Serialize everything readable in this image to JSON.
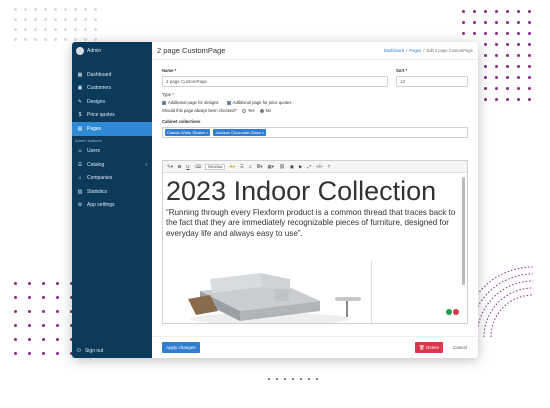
{
  "sidebar": {
    "user": "Admin",
    "items": [
      {
        "label": "Dashboard",
        "icon": "dashboard-icon"
      },
      {
        "label": "Customers",
        "icon": "customers-icon"
      },
      {
        "label": "Designs",
        "icon": "designs-icon"
      },
      {
        "label": "Price quotes",
        "icon": "price-icon"
      },
      {
        "label": "Pages",
        "icon": "pages-icon"
      }
    ],
    "section": "Admin features",
    "admin_items": [
      {
        "label": "Users",
        "icon": "users-icon"
      },
      {
        "label": "Catalog",
        "icon": "catalog-icon"
      },
      {
        "label": "Companies",
        "icon": "companies-icon"
      },
      {
        "label": "Statistics",
        "icon": "statistics-icon"
      },
      {
        "label": "App settings",
        "icon": "settings-icon"
      }
    ],
    "signout": "Sign out"
  },
  "header": {
    "title": "2 page CustomPage",
    "breadcrumb": [
      "Dashboard",
      "Pages",
      "Edit 2 page CustomPage"
    ]
  },
  "form": {
    "name_label": "Name *",
    "name_value": "2 page CustomPage",
    "sort_label": "Sort *",
    "sort_value": "12",
    "type_label": "Type *",
    "opt_designs": "Additional page for designs",
    "opt_quotes": "Additional page for price quotes",
    "always_checked": "Should this page always been checked?",
    "yes": "Yes",
    "no": "No",
    "collections_label": "Cabinet collections",
    "collections": [
      "Classic White Shaker ×",
      "Jackson Chocolate Glaze ×"
    ]
  },
  "editor": {
    "font": "Helvetica",
    "heading": "2023 Indoor Collection",
    "quote": "“Running through every Flexform product is a common thread that traces back to the fact that they are immediately recognizable pieces of furniture, designed for everyday life and always easy to use”."
  },
  "footer": {
    "apply": "Apply changes",
    "delete": "Delete",
    "cancel": "Cancel"
  },
  "colors": {
    "sidebar": "#0b3a5b",
    "accent": "#2f7ed1",
    "danger": "#d9374b",
    "dots": "#8b2a8a"
  }
}
